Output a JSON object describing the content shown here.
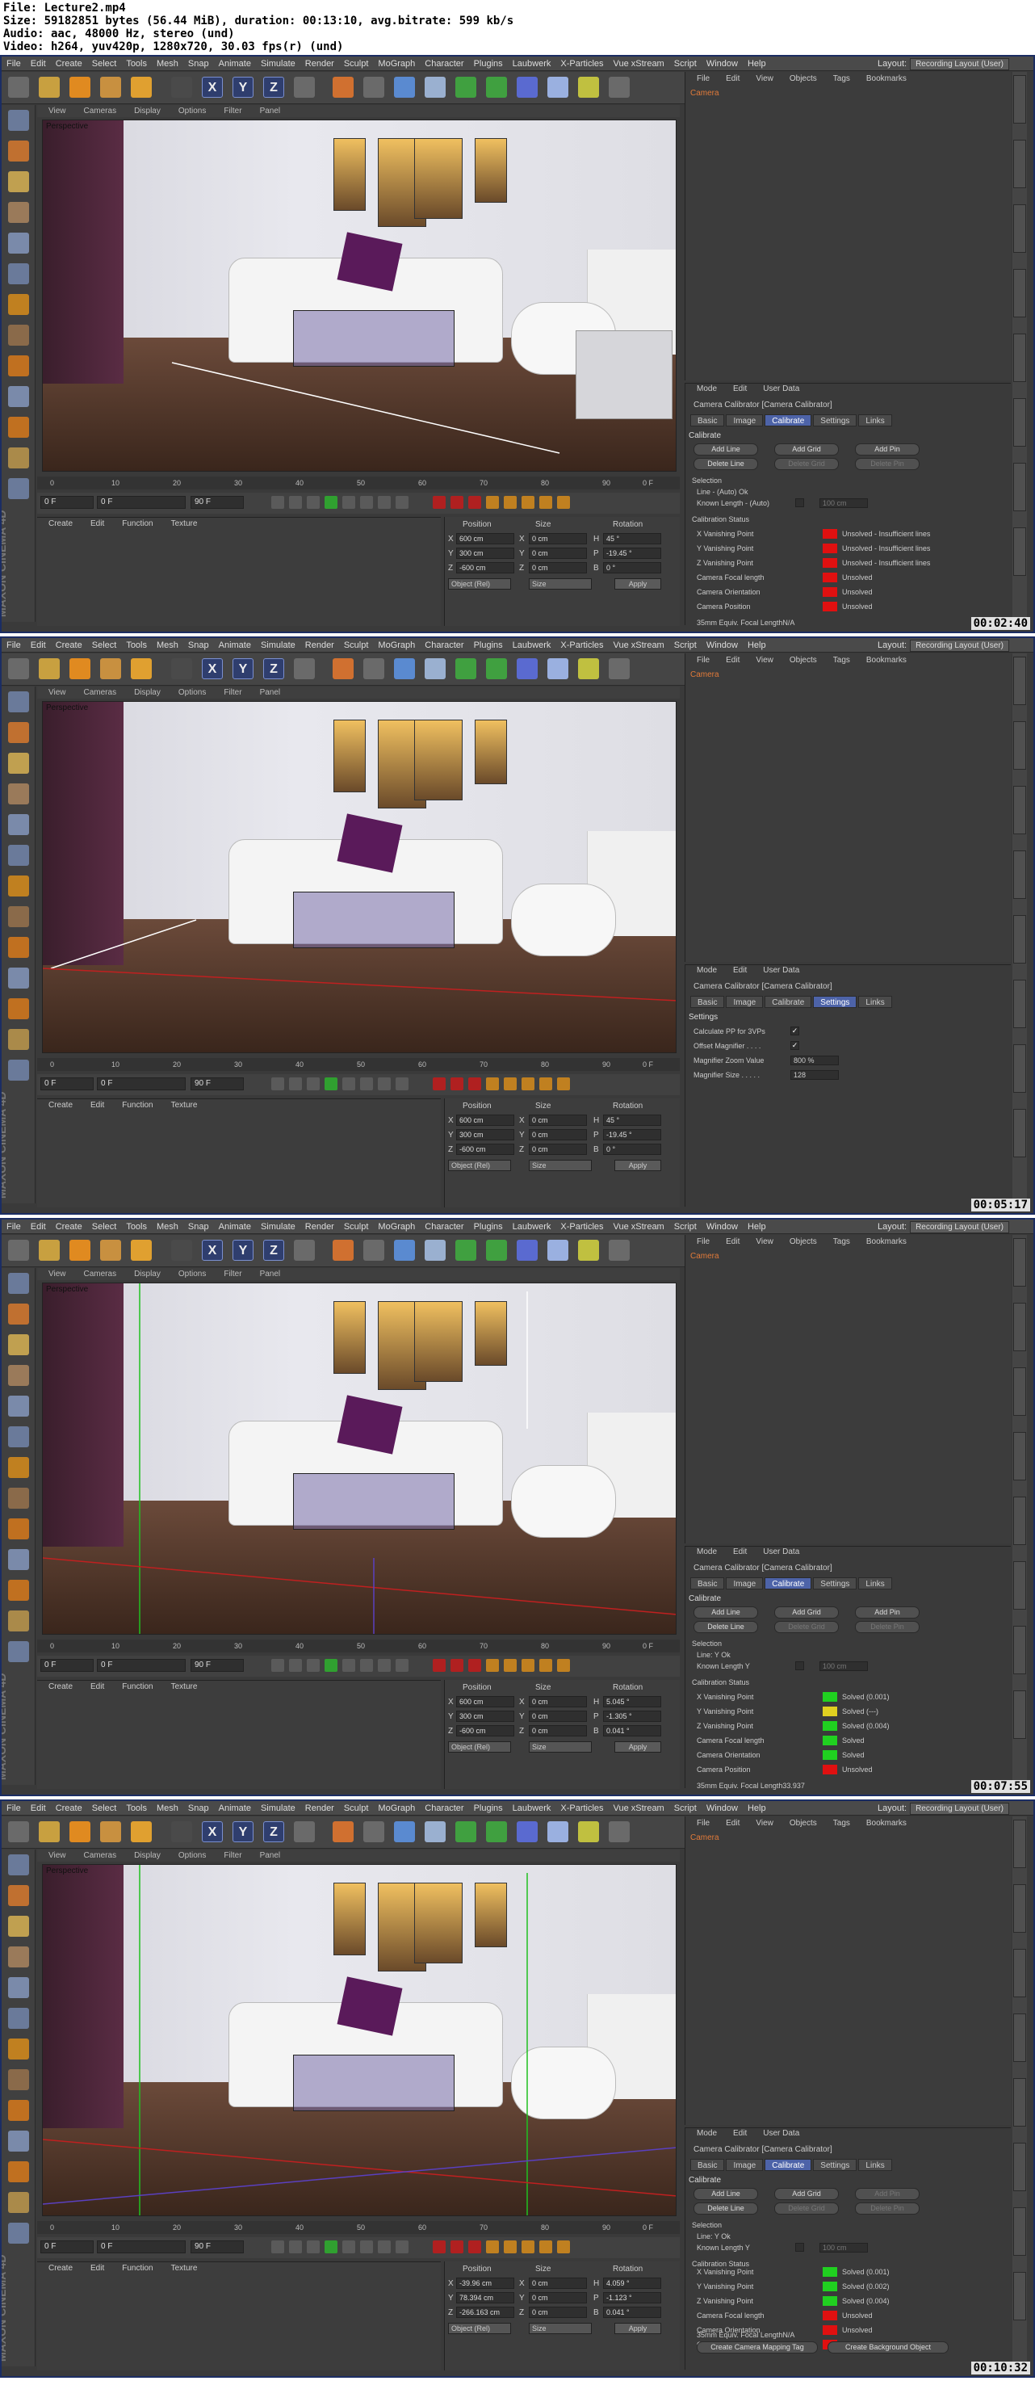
{
  "file_info": {
    "line1": "File: Lecture2.mp4",
    "line2": "Size: 59182851 bytes (56.44 MiB), duration: 00:13:10, avg.bitrate: 599 kb/s",
    "line3": "Audio: aac, 48000 Hz, stereo (und)",
    "line4": "Video: h264, yuv420p, 1280x720, 30.03 fps(r) (und)"
  },
  "menu": [
    "File",
    "Edit",
    "Create",
    "Select",
    "Tools",
    "Mesh",
    "Snap",
    "Animate",
    "Simulate",
    "Render",
    "Sculpt",
    "MoGraph",
    "Character",
    "Plugins",
    "Laubwerk",
    "X-Particles",
    "Vue xStream",
    "Script",
    "Window",
    "Help"
  ],
  "layout_label": "Layout:",
  "layout_value": "Recording Layout (User)",
  "viewport_menu": [
    "View",
    "Cameras",
    "Display",
    "Options",
    "Filter",
    "Panel"
  ],
  "viewport_label": "Perspective",
  "timeline_ticks": [
    "0",
    "10",
    "20",
    "30",
    "40",
    "50",
    "60",
    "70",
    "80",
    "90"
  ],
  "timeline_end": "0 F",
  "transport": {
    "start": "0 F",
    "cur": "0 F",
    "end": "90 F",
    "end2": "90 F"
  },
  "materials_menu": [
    "Create",
    "Edit",
    "Function",
    "Texture"
  ],
  "maxon": "MAXON CINEMA 4D",
  "coords_headers": {
    "pos": "Position",
    "size": "Size",
    "rot": "Rotation"
  },
  "object_menu": [
    "File",
    "Edit",
    "View",
    "Objects",
    "Tags",
    "Bookmarks"
  ],
  "object_name": "Camera",
  "attr_menu": [
    "Mode",
    "Edit",
    "User Data"
  ],
  "attr_title": "Camera Calibrator [Camera Calibrator]",
  "attr_tabs": [
    "Basic",
    "Image",
    "Calibrate",
    "Settings",
    "Links"
  ],
  "frames": [
    {
      "timestamp": "00:02:40",
      "active_tab": 2,
      "panel": "calibrate",
      "coords": {
        "px": "600 cm",
        "py": "300 cm",
        "pz": "-600 cm",
        "sx": "0 cm",
        "sy": "0 cm",
        "sz": "0 cm",
        "rh": "45 °",
        "rp": "-19.45 °",
        "rb": "0 °",
        "mode": "Object (Rel)",
        "size": "Size",
        "apply": "Apply"
      },
      "calibrate": {
        "header": "Calibrate",
        "buttons": [
          "Add Line",
          "Add Grid",
          "Add Pin",
          "Delete Line",
          "Delete Grid",
          "Delete Pin"
        ],
        "selection": "Selection",
        "sel_line": "Line - (Auto) Ok",
        "known_length": "Known Length - (Auto)",
        "known_value": "100 cm",
        "status_header": "Calibration Status",
        "status": [
          {
            "label": "X Vanishing Point",
            "value": "Unsolved - Insufficient lines",
            "color": "#e01010"
          },
          {
            "label": "Y Vanishing Point",
            "value": "Unsolved - Insufficient lines",
            "color": "#e01010"
          },
          {
            "label": "Z Vanishing Point",
            "value": "Unsolved - Insufficient lines",
            "color": "#e01010"
          },
          {
            "label": "Camera Focal length",
            "value": "Unsolved",
            "color": "#e01010"
          },
          {
            "label": "Camera Orientation",
            "value": "Unsolved",
            "color": "#e01010"
          },
          {
            "label": "Camera Position",
            "value": "Unsolved",
            "color": "#e01010"
          }
        ],
        "focal_equiv": "35mm Equiv. Focal LengthN/A"
      }
    },
    {
      "timestamp": "00:05:17",
      "active_tab": 3,
      "panel": "settings",
      "coords": {
        "px": "600 cm",
        "py": "300 cm",
        "pz": "-600 cm",
        "sx": "0 cm",
        "sy": "0 cm",
        "sz": "0 cm",
        "rh": "45 °",
        "rp": "-19.45 °",
        "rb": "0 °",
        "mode": "Object (Rel)",
        "size": "Size",
        "apply": "Apply"
      },
      "settings": {
        "header": "Settings",
        "rows": [
          {
            "label": "Calculate PP for 3VPs",
            "value": "✓",
            "kind": "check"
          },
          {
            "label": "Offset Magnifier . . . .",
            "value": "✓",
            "kind": "check"
          },
          {
            "label": "Magnifier Zoom Value",
            "value": "800 %",
            "kind": "field"
          },
          {
            "label": "Magnifier Size . . . . .",
            "value": "128",
            "kind": "field"
          }
        ]
      }
    },
    {
      "timestamp": "00:07:55",
      "active_tab": 2,
      "panel": "calibrate",
      "coords": {
        "px": "600 cm",
        "py": "300 cm",
        "pz": "-600 cm",
        "sx": "0 cm",
        "sy": "0 cm",
        "sz": "0 cm",
        "rh": "5.045 °",
        "rp": "-1.305 °",
        "rb": "0.041 °",
        "mode": "Object (Rel)",
        "size": "Size",
        "apply": "Apply"
      },
      "calibrate": {
        "header": "Calibrate",
        "buttons": [
          "Add Line",
          "Add Grid",
          "Add Pin",
          "Delete Line",
          "Delete Grid",
          "Delete Pin"
        ],
        "selection": "Selection",
        "sel_line": "Line: Y Ok",
        "known_length": "Known Length Y",
        "known_value": "100 cm",
        "status_header": "Calibration Status",
        "status": [
          {
            "label": "X Vanishing Point",
            "value": "Solved (0.001)",
            "color": "#20d020"
          },
          {
            "label": "Y Vanishing Point",
            "value": "Solved (---)",
            "color": "#e0d020"
          },
          {
            "label": "Z Vanishing Point",
            "value": "Solved (0.004)",
            "color": "#20d020"
          },
          {
            "label": "Camera Focal length",
            "value": "Solved",
            "color": "#20d020"
          },
          {
            "label": "Camera Orientation",
            "value": "Solved",
            "color": "#20d020"
          },
          {
            "label": "Camera Position",
            "value": "Unsolved",
            "color": "#e01010"
          }
        ],
        "focal_equiv": "35mm Equiv. Focal Length33.937"
      }
    },
    {
      "timestamp": "00:10:32",
      "active_tab": 2,
      "panel": "calibrate",
      "coords": {
        "px": "-39.96 cm",
        "py": "78.394 cm",
        "pz": "-266.163 cm",
        "sx": "0 cm",
        "sy": "0 cm",
        "sz": "0 cm",
        "rh": "4.059 °",
        "rp": "-1.123 °",
        "rb": "0.041 °",
        "mode": "Object (Rel)",
        "size": "Size",
        "apply": "Apply"
      },
      "calibrate": {
        "header": "Calibrate",
        "buttons": [
          "Add Line",
          "Add Grid",
          "Add Pin",
          "Delete Line",
          "Delete Grid",
          "Delete Pin"
        ],
        "selection": "Selection",
        "sel_line": "Line: Y Ok",
        "known_length": "Known Length Y",
        "known_value": "100 cm",
        "status_header": "Calibration Status",
        "status": [
          {
            "label": "X Vanishing Point",
            "value": "Solved (0.001)",
            "color": "#20d020"
          },
          {
            "label": "Y Vanishing Point",
            "value": "Solved (0.002)",
            "color": "#20d020"
          },
          {
            "label": "Z Vanishing Point",
            "value": "Solved (0.004)",
            "color": "#20d020"
          },
          {
            "label": "Camera Focal length",
            "value": "Unsolved",
            "color": "#e01010"
          },
          {
            "label": "Camera Orientation",
            "value": "Unsolved",
            "color": "#e01010"
          },
          {
            "label": "Camera Position",
            "value": "Unsolved",
            "color": "#e01010"
          }
        ],
        "focal_equiv": "35mm Equiv. Focal LengthN/A",
        "extra_buttons": [
          "Create Camera Mapping Tag",
          "Create Background Object"
        ]
      }
    }
  ]
}
